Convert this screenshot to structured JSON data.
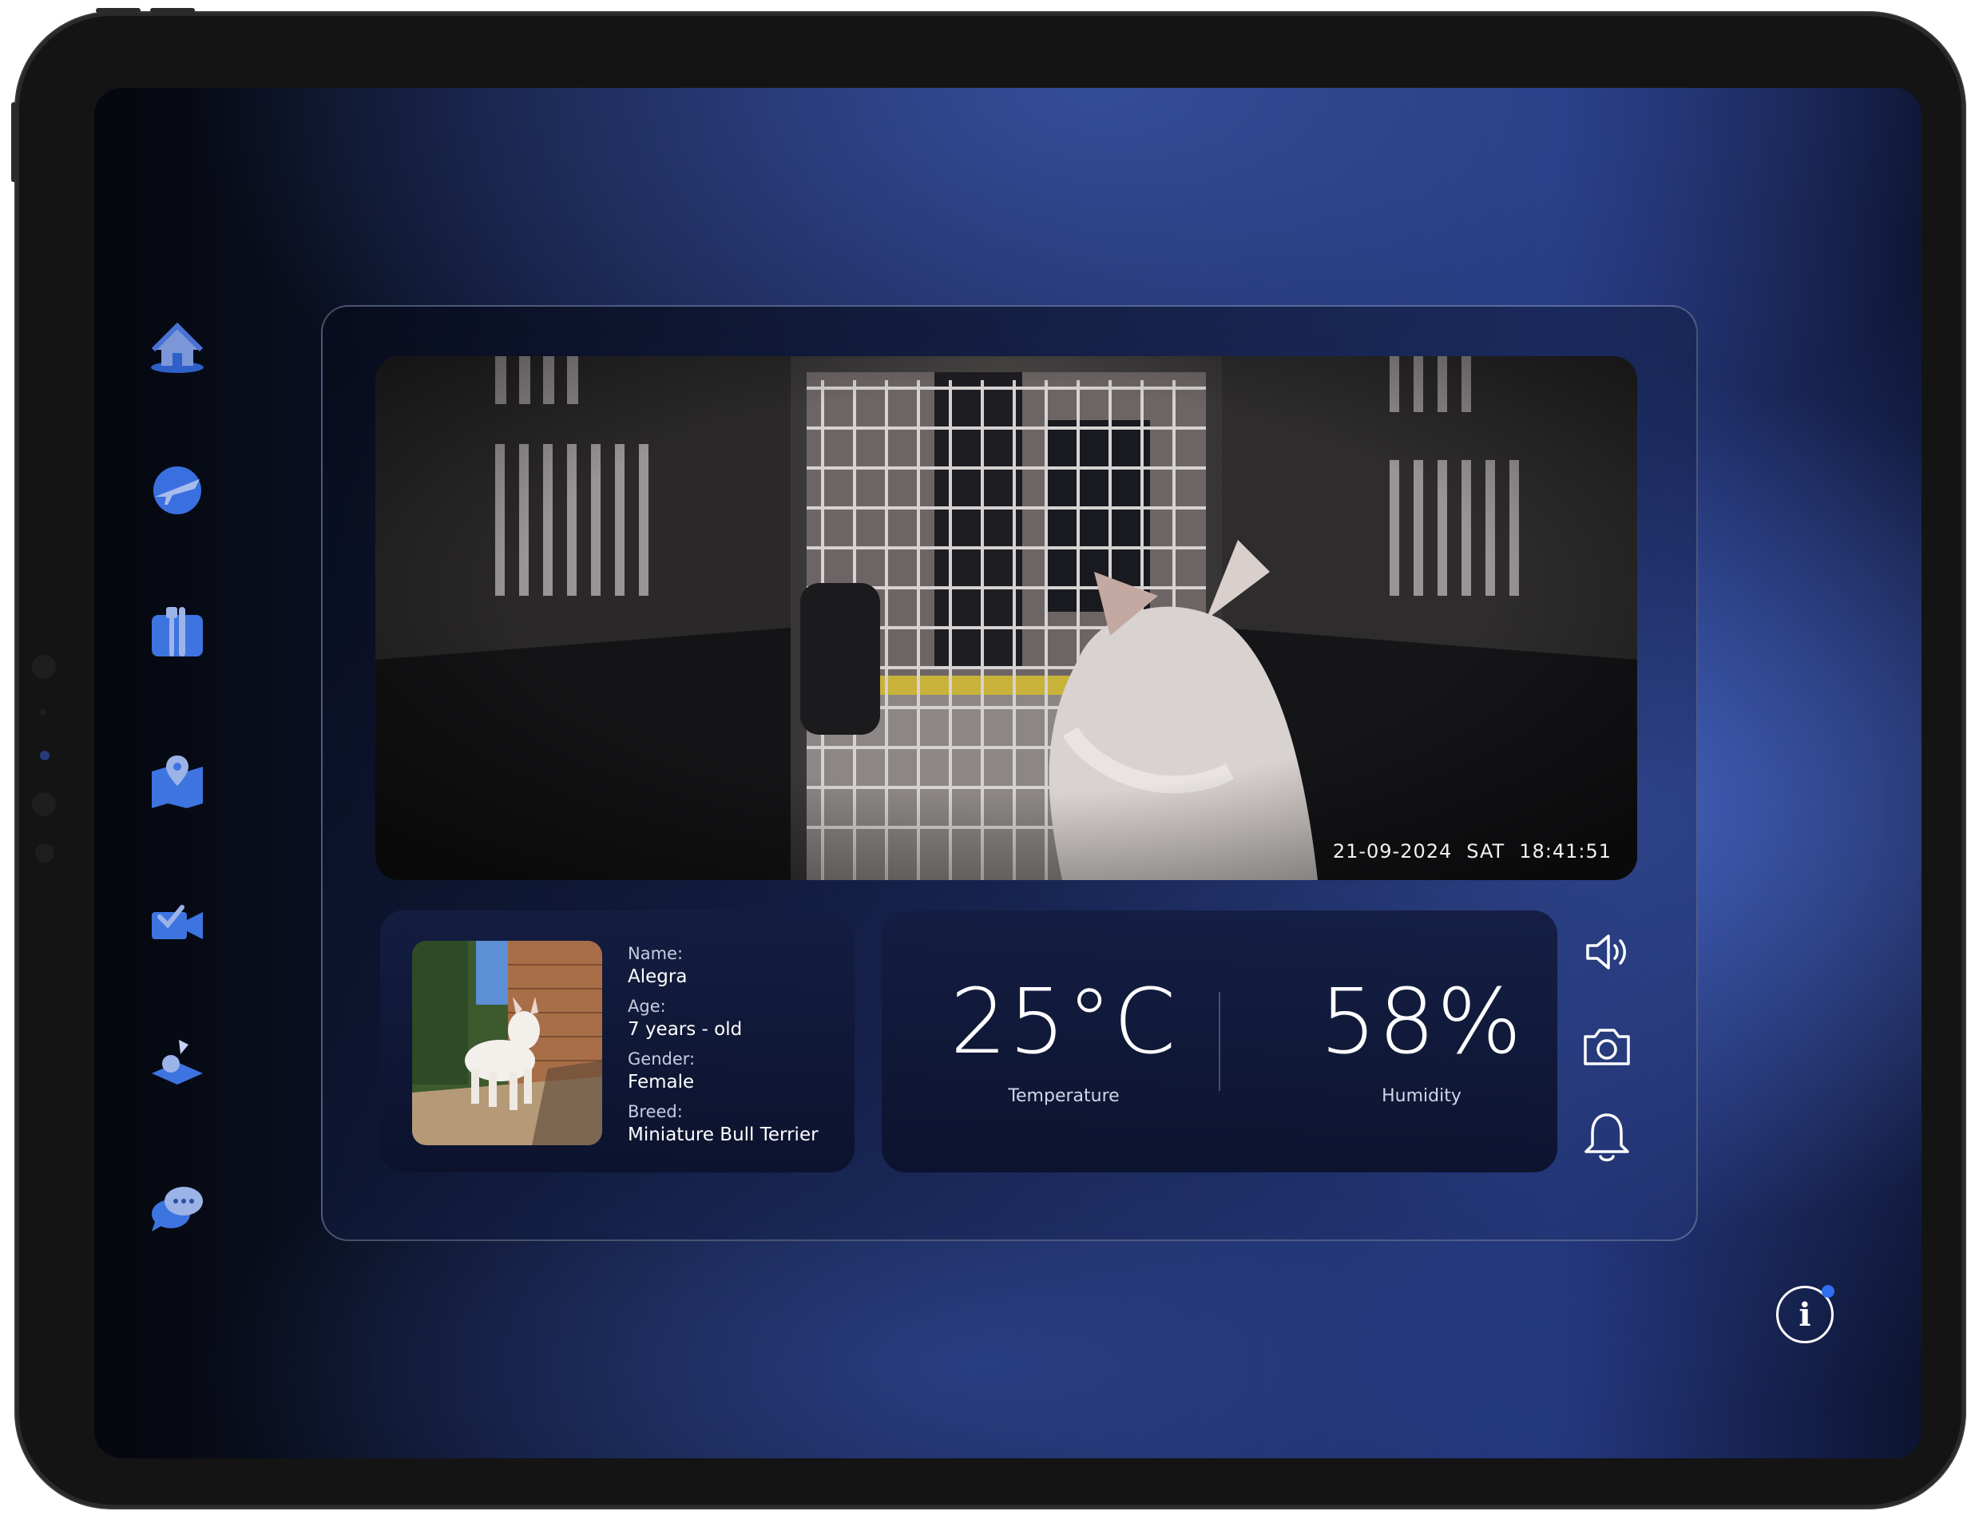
{
  "nav": {
    "items": [
      {
        "id": "home",
        "icon": "home-icon"
      },
      {
        "id": "flight",
        "icon": "airplane-icon"
      },
      {
        "id": "food",
        "icon": "food-icon"
      },
      {
        "id": "map",
        "icon": "map-pin-icon"
      },
      {
        "id": "camera",
        "icon": "video-camera-icon"
      },
      {
        "id": "play",
        "icon": "toys-icon"
      },
      {
        "id": "chat",
        "icon": "chat-icon"
      }
    ]
  },
  "video": {
    "date": "21-09-2024",
    "day": "SAT",
    "time": "18:41:51"
  },
  "pet": {
    "name_label": "Name:",
    "name": "Alegra",
    "age_label": "Age:",
    "age": "7 years - old",
    "gender_label": "Gender:",
    "gender": "Female",
    "breed_label": "Breed:",
    "breed": "Miniature Bull Terrier"
  },
  "environment": {
    "temperature": "25°C",
    "temperature_label": "Temperature",
    "humidity": "58%",
    "humidity_label": "Humidity"
  },
  "tools": {
    "sound_icon": "speaker-icon",
    "photo_icon": "camera-icon",
    "alert_icon": "bell-icon"
  },
  "info": {
    "glyph": "i"
  },
  "colors": {
    "accent": "#2f6ff0",
    "icon_blue": "#3d74e0"
  }
}
